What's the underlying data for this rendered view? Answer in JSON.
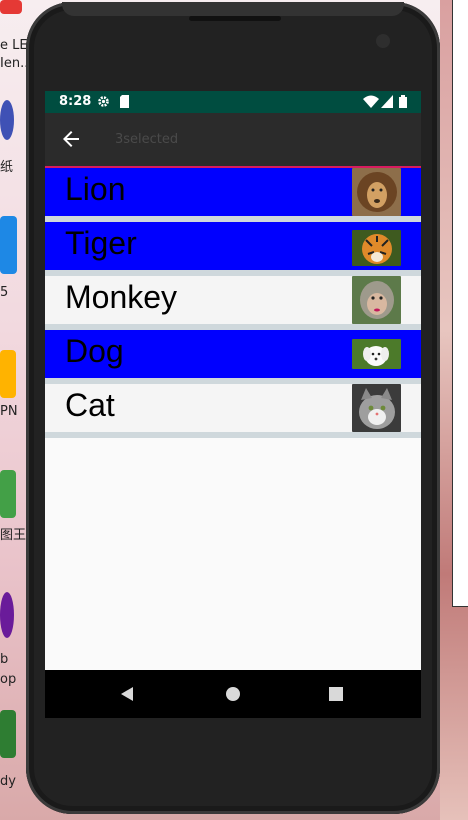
{
  "desktop": {
    "labels": [
      "e LE",
      "Ien...",
      "纸",
      "5",
      "PN",
      "图王",
      "b",
      "op",
      "dy"
    ]
  },
  "status_bar": {
    "time": "8:28",
    "icons": [
      "gear-icon",
      "sim-card-icon",
      "wifi-icon",
      "signal-icon",
      "battery-icon"
    ]
  },
  "app_bar": {
    "title": "3selected",
    "back_icon": "arrow-left-icon"
  },
  "animals": [
    {
      "name": "Lion",
      "selected": true,
      "image": "lion-image"
    },
    {
      "name": "Tiger",
      "selected": true,
      "image": "tiger-image"
    },
    {
      "name": "Monkey",
      "selected": false,
      "image": "monkey-image"
    },
    {
      "name": "Dog",
      "selected": true,
      "image": "dog-image"
    },
    {
      "name": "Cat",
      "selected": false,
      "image": "cat-image"
    }
  ],
  "colors": {
    "selected_row": "#0000ff",
    "unselected_row": "#f5f5f5",
    "status_bar": "#004d40",
    "app_bar": "#2b2b2b",
    "accent": "#d81b60"
  },
  "nav_bar": {
    "buttons": [
      "back-triangle-icon",
      "home-circle-icon",
      "recents-square-icon"
    ]
  }
}
